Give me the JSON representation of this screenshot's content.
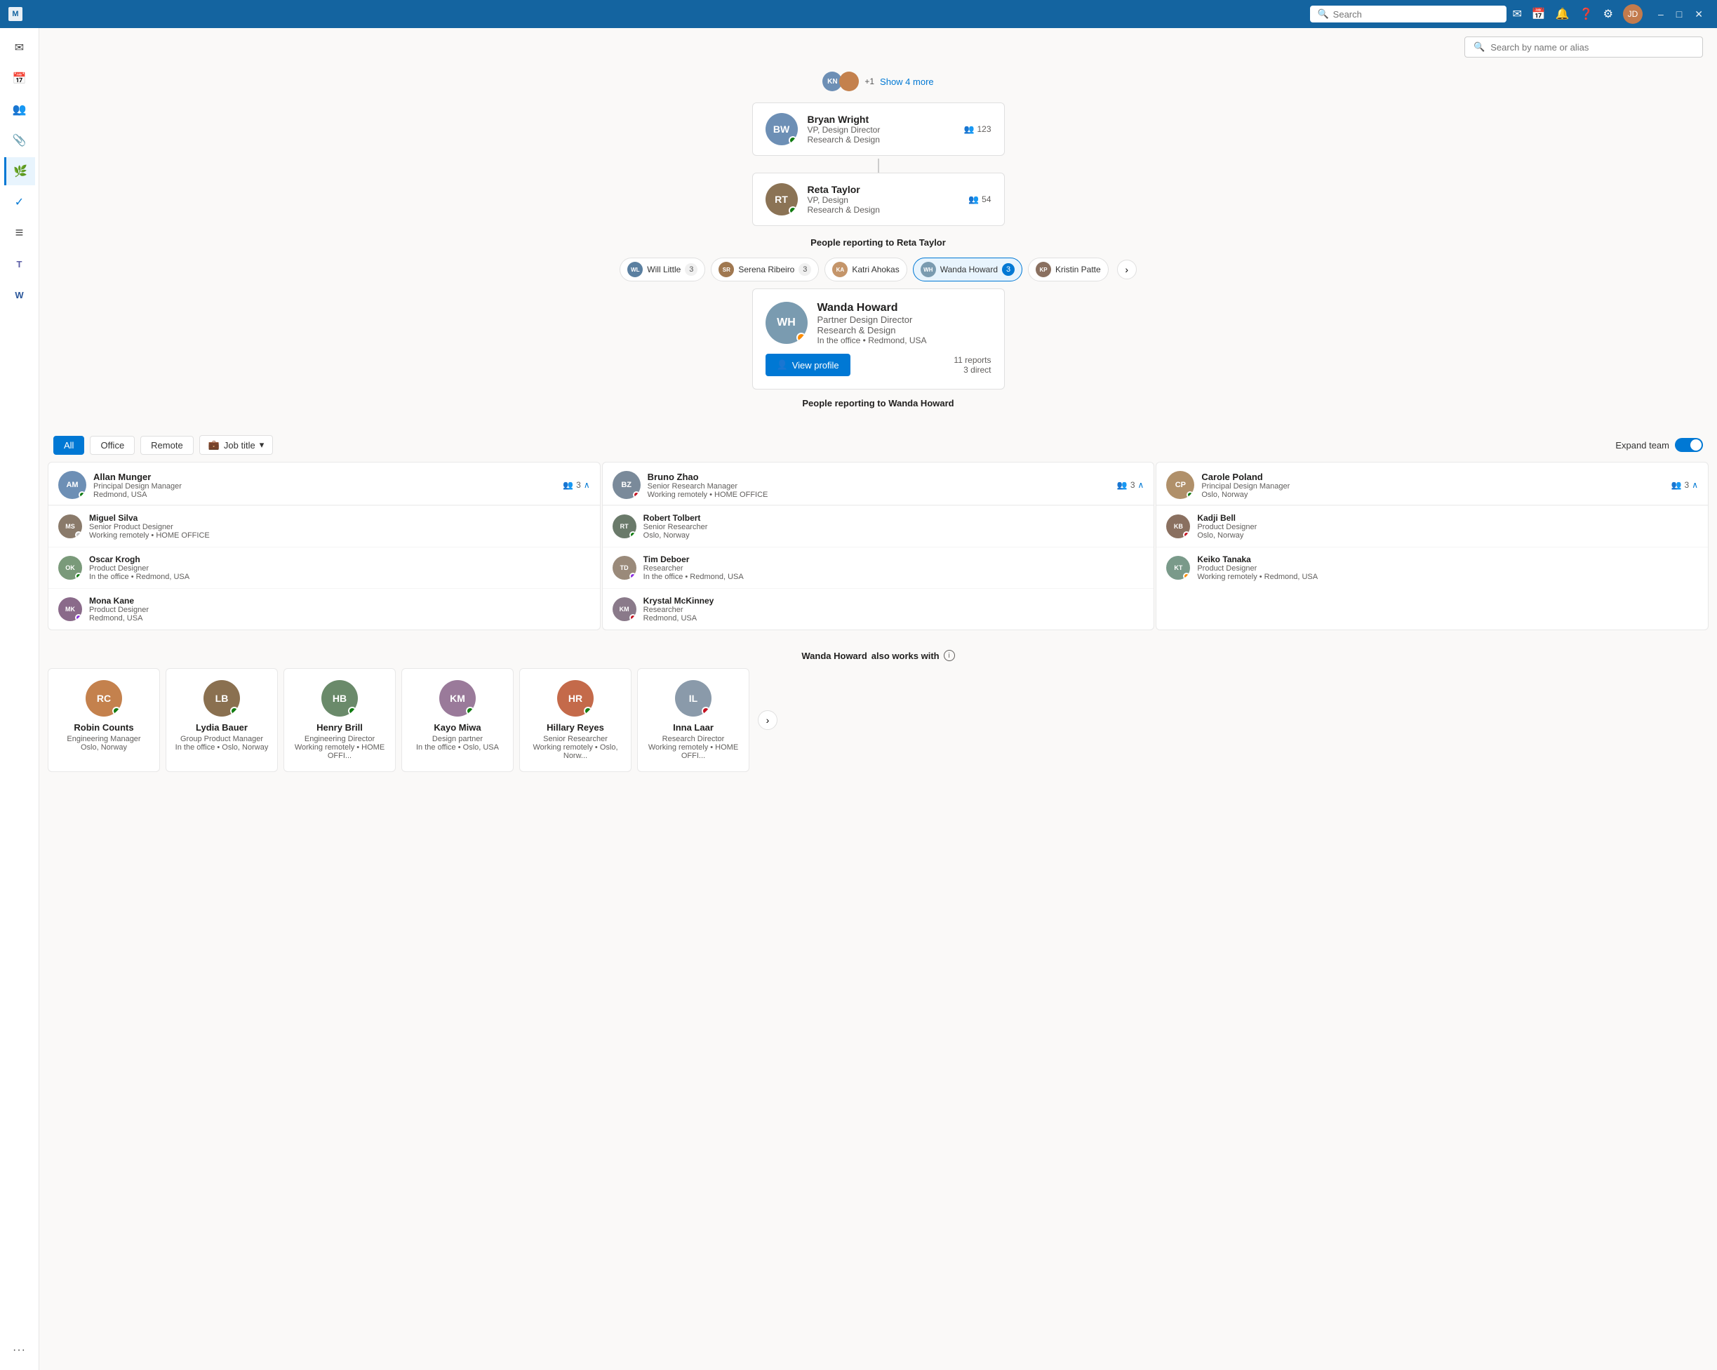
{
  "titlebar": {
    "search_placeholder": "Search",
    "icons": [
      "mail",
      "calendar",
      "people",
      "bell",
      "question",
      "settings"
    ],
    "user_initials": "JD",
    "window_buttons": [
      "–",
      "□",
      "✕"
    ]
  },
  "top_search": {
    "placeholder": "Search by name or alias"
  },
  "sidebar": {
    "items": [
      {
        "id": "mail",
        "icon": "✉",
        "active": false
      },
      {
        "id": "calendar",
        "icon": "📅",
        "active": false
      },
      {
        "id": "people",
        "icon": "👥",
        "active": false
      },
      {
        "id": "attach",
        "icon": "📎",
        "active": false
      },
      {
        "id": "org",
        "icon": "🌿",
        "active": true
      },
      {
        "id": "check",
        "icon": "✓",
        "active": false
      },
      {
        "id": "list",
        "icon": "≡",
        "active": false
      },
      {
        "id": "teams",
        "icon": "T",
        "active": false
      },
      {
        "id": "word",
        "icon": "W",
        "active": false
      },
      {
        "id": "more",
        "icon": "•••",
        "active": false
      }
    ]
  },
  "show_more": {
    "count_label": "+1",
    "show_label": "Show 4 more"
  },
  "org_cards": [
    {
      "name": "Bryan Wright",
      "title": "VP, Design Director",
      "dept": "Research & Design",
      "reports": "123",
      "status": "green",
      "initials": "BW",
      "bg": "#6d8fb5"
    },
    {
      "name": "Reta Taylor",
      "title": "VP, Design",
      "dept": "Research & Design",
      "reports": "54",
      "status": "green",
      "initials": "RT",
      "bg": "#8b7355"
    }
  ],
  "reporting_label_reta": "People reporting to",
  "reporting_name_reta": "Reta Taylor",
  "people_chips": [
    {
      "name": "Will Little",
      "count": "3",
      "active": false,
      "initials": "WL",
      "bg": "#5a7fa0"
    },
    {
      "name": "Serena Ribeiro",
      "count": "3",
      "active": false,
      "initials": "SR",
      "bg": "#a07850"
    },
    {
      "name": "Katri Ahokas",
      "count": "",
      "active": false,
      "initials": "KA",
      "bg": "#c4956a"
    },
    {
      "name": "Wanda Howard",
      "count": "3",
      "active": true,
      "initials": "WH",
      "bg": "#7a9bb0"
    },
    {
      "name": "Kristin Patte",
      "count": "",
      "active": false,
      "initials": "KP",
      "bg": "#8a7060"
    }
  ],
  "selected_person": {
    "name": "Wanda Howard",
    "title": "Partner Design Director",
    "dept": "Research & Design",
    "location": "In the office • Redmond, USA",
    "status": "orange",
    "initials": "WH",
    "bg": "#7a9bb0",
    "reports_total": "11 reports",
    "reports_direct": "3 direct",
    "view_profile_label": "View profile"
  },
  "reporting_label_wanda": "People reporting to",
  "reporting_name_wanda": "Wanda Howard",
  "filter_buttons": [
    {
      "label": "All",
      "active": true
    },
    {
      "label": "Office",
      "active": false
    },
    {
      "label": "Remote",
      "active": false
    }
  ],
  "job_title_filter": "Job title",
  "expand_team": {
    "label": "Expand team",
    "on": true
  },
  "team_columns": [
    {
      "manager": {
        "name": "Allan Munger",
        "title": "Principal Design Manager",
        "location": "Redmond, USA",
        "reports": "3",
        "status": "green",
        "initials": "AM",
        "bg": "#6d8fb5"
      },
      "members": [
        {
          "name": "Miguel Silva",
          "title": "Senior Product Designer",
          "location": "Working remotely • HOME OFFICE",
          "status": "none",
          "initials": "MS",
          "bg": "#8a7a6a"
        },
        {
          "name": "Oscar Krogh",
          "title": "Product Designer",
          "location": "In the office • Redmond, USA",
          "status": "green",
          "initials": "OK",
          "bg": "#7a9a7a"
        },
        {
          "name": "Mona Kane",
          "title": "Product Designer",
          "location": "Redmond, USA",
          "status": "purple",
          "initials": "MK",
          "bg": "#8a6a8a"
        }
      ]
    },
    {
      "manager": {
        "name": "Bruno Zhao",
        "title": "Senior Research Manager",
        "location": "Working remotely • HOME OFFICE",
        "reports": "3",
        "status": "red",
        "initials": "BZ",
        "bg": "#7a8a9a"
      },
      "members": [
        {
          "name": "Robert Tolbert",
          "title": "Senior Researcher",
          "location": "Oslo, Norway",
          "status": "green",
          "initials": "RT",
          "bg": "#6a7a6a"
        },
        {
          "name": "Tim Deboer",
          "title": "Researcher",
          "location": "In the office • Redmond, USA",
          "status": "purple",
          "initials": "TD",
          "bg": "#9a8a7a"
        },
        {
          "name": "Krystal McKinney",
          "title": "Researcher",
          "location": "Redmond, USA",
          "status": "red",
          "initials": "KM",
          "bg": "#8a7a8a"
        }
      ]
    },
    {
      "manager": {
        "name": "Carole Poland",
        "title": "Principal Design Manager",
        "location": "Oslo, Norway",
        "reports": "3",
        "status": "green",
        "initials": "CP",
        "bg": "#b0906a"
      },
      "members": [
        {
          "name": "Kadji Bell",
          "title": "Product Designer",
          "location": "Oslo, Norway",
          "status": "red",
          "initials": "KB",
          "bg": "#8a7060"
        },
        {
          "name": "Keiko Tanaka",
          "title": "Product Designer",
          "location": "Working remotely • Redmond, USA",
          "status": "orange",
          "initials": "KT",
          "bg": "#7a9a8a"
        }
      ]
    }
  ],
  "also_works_with_label": "also works with",
  "also_works_with_name": "Wanda Howard",
  "also_works_people": [
    {
      "name": "Robin Counts",
      "title": "Engineering Manager",
      "location": "Oslo, Norway",
      "status": "green",
      "initials": "RC",
      "bg": "#c4814d"
    },
    {
      "name": "Lydia Bauer",
      "title": "Group Product Manager",
      "location": "In the office • Oslo, Norway",
      "status": "green",
      "initials": "LB",
      "bg": "#8a7050"
    },
    {
      "name": "Henry Brill",
      "title": "Engineering Director",
      "location": "Working remotely • HOME OFFI...",
      "status": "green",
      "initials": "HB",
      "bg": "#6a8a6a"
    },
    {
      "name": "Kayo Miwa",
      "title": "Design partner",
      "location": "In the office • Oslo, USA",
      "status": "green",
      "initials": "KM",
      "bg": "#9a7a9a"
    },
    {
      "name": "Hillary Reyes",
      "title": "Senior Researcher",
      "location": "Working remotely • Oslo, Norw...",
      "status": "green",
      "initials": "HR",
      "bg": "#c46a4a"
    },
    {
      "name": "Inna Laar",
      "title": "Research Director",
      "location": "Working remotely • HOME OFFI...",
      "status": "red",
      "initials": "IL",
      "bg": "#8a9aaa"
    }
  ]
}
